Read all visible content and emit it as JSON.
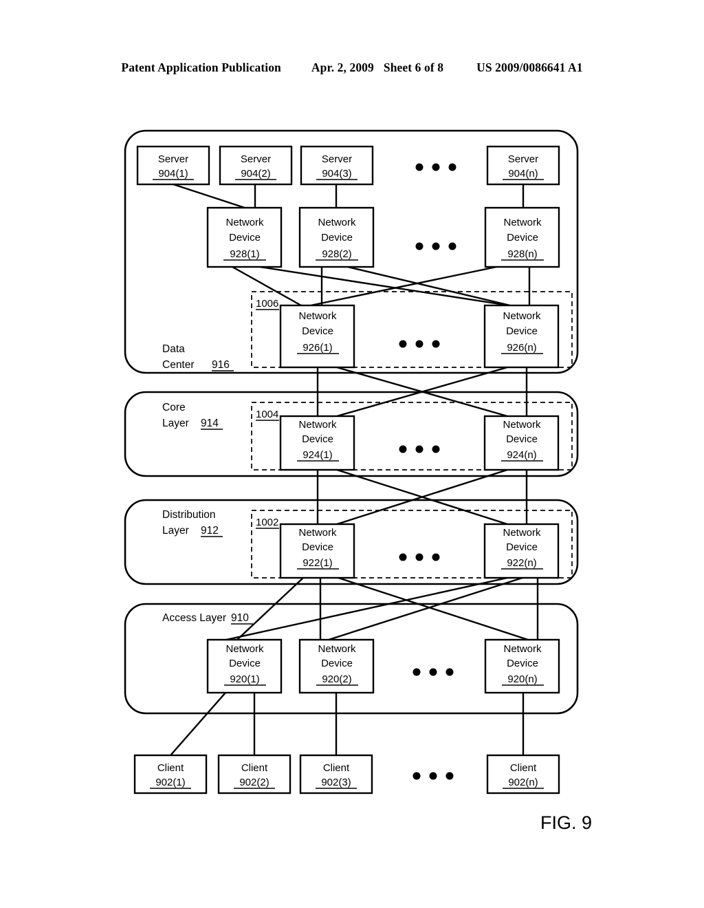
{
  "header": {
    "publication": "Patent Application Publication",
    "date": "Apr. 2, 2009",
    "sheet": "Sheet 6 of 8",
    "patent_number": "US 2009/0086641 A1"
  },
  "figure": {
    "caption": "FIG. 9",
    "ellipsis_glyph": "• • •"
  },
  "regions": [
    {
      "id": "data-center",
      "label_line1": "Data",
      "label_line2": "Center",
      "ref": "916"
    },
    {
      "id": "core-layer",
      "label_line1": "Core",
      "label_line2": "Layer",
      "ref": "914"
    },
    {
      "id": "distribution-layer",
      "label_line1": "Distribution",
      "label_line2": "Layer",
      "ref": "912"
    },
    {
      "id": "access-layer",
      "label_line1": "Access Layer",
      "label_line2": "",
      "ref": "910"
    }
  ],
  "dashed_groups": [
    {
      "id": "group-1006",
      "ref": "1006"
    },
    {
      "id": "group-1004",
      "ref": "1004"
    },
    {
      "id": "group-1002",
      "ref": "1002"
    }
  ],
  "rows": {
    "servers": {
      "type_label": "Server",
      "nodes": [
        {
          "ref": "904(1)"
        },
        {
          "ref": "904(2)"
        },
        {
          "ref": "904(3)"
        },
        {
          "ref": "904(n)"
        }
      ]
    },
    "network_devices_928": {
      "type_line1": "Network",
      "type_line2": "Device",
      "nodes": [
        {
          "ref": "928(1)"
        },
        {
          "ref": "928(2)"
        },
        {
          "ref": "928(n)"
        }
      ]
    },
    "network_devices_926": {
      "type_line1": "Network",
      "type_line2": "Device",
      "nodes": [
        {
          "ref": "926(1)"
        },
        {
          "ref": "926(n)"
        }
      ]
    },
    "network_devices_924": {
      "type_line1": "Network",
      "type_line2": "Device",
      "nodes": [
        {
          "ref": "924(1)"
        },
        {
          "ref": "924(n)"
        }
      ]
    },
    "network_devices_922": {
      "type_line1": "Network",
      "type_line2": "Device",
      "nodes": [
        {
          "ref": "922(1)"
        },
        {
          "ref": "922(n)"
        }
      ]
    },
    "network_devices_920": {
      "type_line1": "Network",
      "type_line2": "Device",
      "nodes": [
        {
          "ref": "920(1)"
        },
        {
          "ref": "920(2)"
        },
        {
          "ref": "920(n)"
        }
      ]
    },
    "clients": {
      "type_label": "Client",
      "nodes": [
        {
          "ref": "902(1)"
        },
        {
          "ref": "902(2)"
        },
        {
          "ref": "902(3)"
        },
        {
          "ref": "902(n)"
        }
      ]
    }
  },
  "colors": {
    "ink": "#000000",
    "paper": "#ffffff"
  }
}
